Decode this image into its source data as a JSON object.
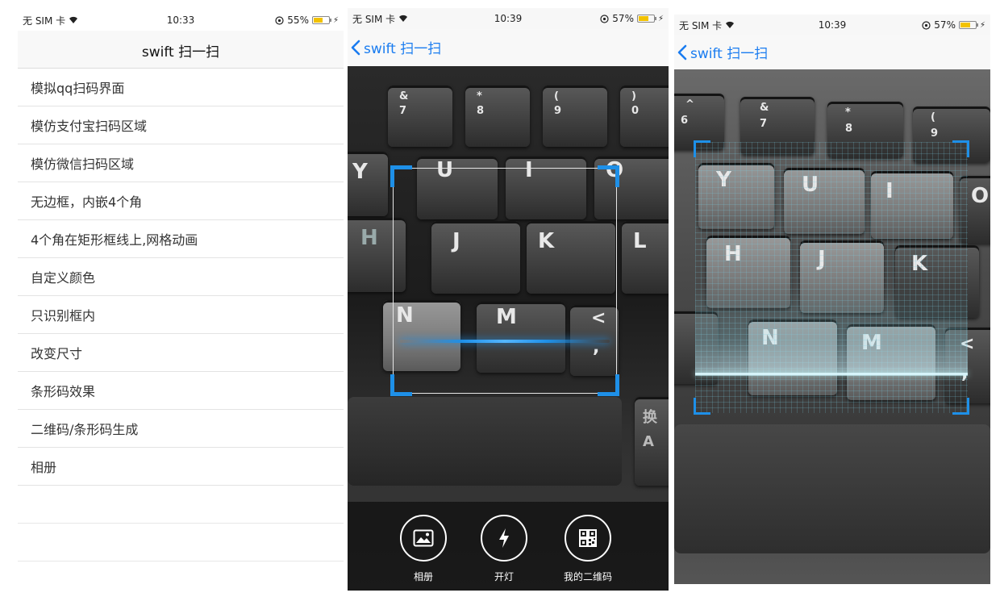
{
  "screen1": {
    "status": {
      "carrier": "无 SIM 卡",
      "time": "10:33",
      "battery": "55%",
      "battery_level": 0.55
    },
    "title": "swift 扫一扫",
    "items": [
      "模拟qq扫码界面",
      "模仿支付宝扫码区域",
      "模仿微信扫码区域",
      "无边框，内嵌4个角",
      "4个角在矩形框线上,网格动画",
      "自定义颜色",
      "只识别框内",
      "改变尺寸",
      "条形码效果",
      "二维码/条形码生成",
      "相册"
    ]
  },
  "screen2": {
    "status": {
      "carrier": "无 SIM 卡",
      "time": "10:39",
      "battery": "57%",
      "battery_level": 0.57
    },
    "back_label": "swift 扫一扫",
    "keys": {
      "u": "U",
      "i": "I",
      "o": "O",
      "y": "Y",
      "h": "H",
      "j": "J",
      "k": "K",
      "l": "L",
      "n": "N",
      "m": "M",
      "lt": "<",
      "comma": ",",
      "amp": "&",
      "seven": "7",
      "star": "*",
      "eight": "8",
      "lparen": "(",
      "nine": "9",
      "rparen": ")",
      "zero": "0",
      "huan": "换",
      "a": "A"
    },
    "toolbar": {
      "album": "相册",
      "flash": "开灯",
      "my_qr": "我的二维码"
    },
    "accent_color": "#1e90e8"
  },
  "screen3": {
    "status": {
      "carrier": "无 SIM 卡",
      "time": "10:39",
      "battery": "57%",
      "battery_level": 0.57
    },
    "back_label": "swift 扫一扫",
    "keys": {
      "caret": "^",
      "six": "6",
      "amp": "&",
      "seven": "7",
      "star": "*",
      "eight": "8",
      "lparen": "(",
      "nine": "9",
      "y": "Y",
      "u": "U",
      "i": "I",
      "o": "O",
      "h": "H",
      "j": "J",
      "k": "K",
      "n": "N",
      "m": "M",
      "lt": "<",
      "comma": ","
    },
    "accent_color": "#1e90e8"
  }
}
